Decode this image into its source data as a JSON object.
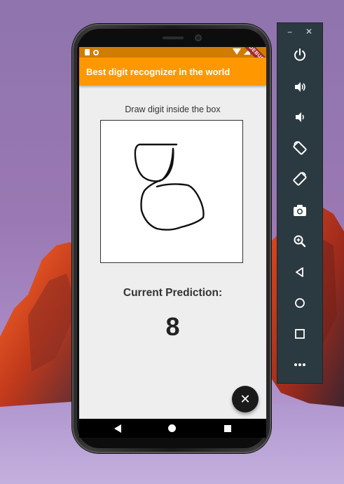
{
  "app_bar": {
    "title": "Best digit recognizer in the world"
  },
  "status_bar": {
    "debug_banner": "DEBUG"
  },
  "canvas": {
    "instruction": "Draw digit inside the box"
  },
  "prediction": {
    "label": "Current Prediction:",
    "value": "8"
  },
  "fab": {
    "icon": "close-icon"
  },
  "navigation": {
    "items": [
      "back-icon",
      "home-icon",
      "recents-icon"
    ]
  },
  "emulator_toolbar": {
    "window_controls": [
      "minimize-icon",
      "close-icon"
    ],
    "items": [
      "power-icon",
      "volume-up-icon",
      "volume-down-icon",
      "rotate-left-icon",
      "rotate-right-icon",
      "camera-icon",
      "zoom-icon",
      "back-icon",
      "home-icon",
      "overview-icon",
      "more-icon"
    ]
  },
  "colors": {
    "app_bar": "#ff9800",
    "status_bar": "#d07c00",
    "screen_bg": "#eeeeee",
    "toolbar_bg": "#2b3a41",
    "fab_bg": "#1a1a1a"
  }
}
